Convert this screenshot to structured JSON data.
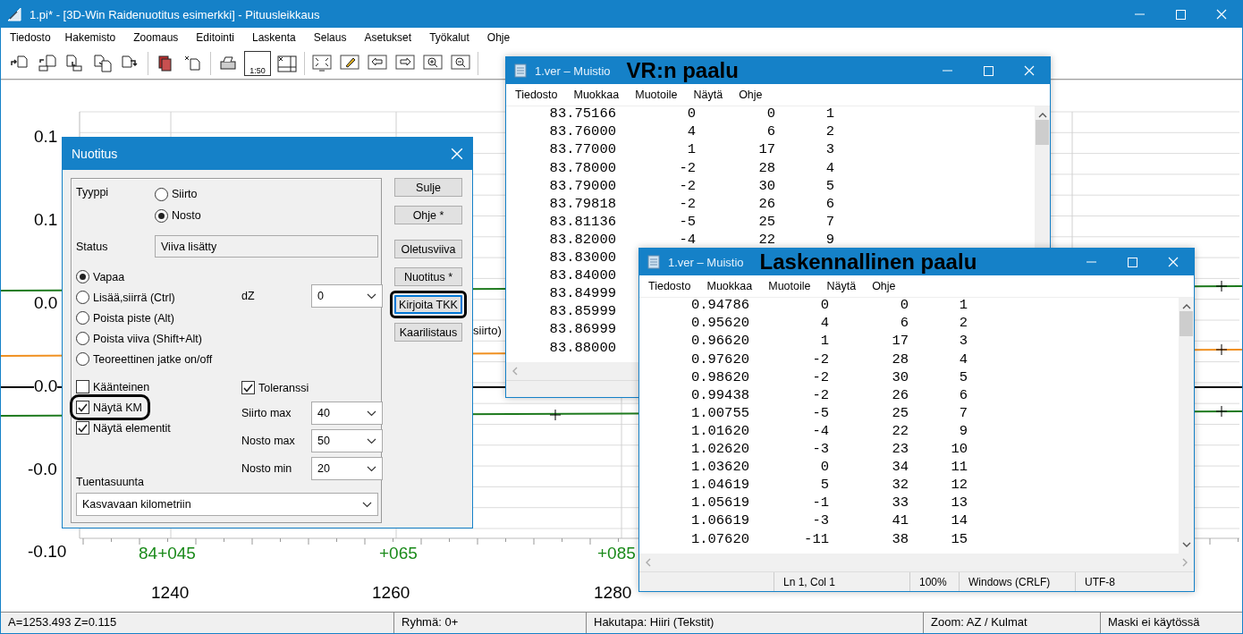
{
  "window": {
    "title": "1.pi* - [3D-Win Raidenuotitus esimerkki] - Pituusleikkaus"
  },
  "menu": [
    "Tiedosto",
    "Hakemisto",
    "Zoomaus",
    "Editointi",
    "Laskenta",
    "Selaus",
    "Asetukset",
    "Työkalut",
    "Ohje"
  ],
  "toolbar": {
    "scale_label": "1:50"
  },
  "chart": {
    "y_labels": [
      "0.1",
      "0.1",
      "0.0",
      "0.0",
      "-0.0",
      "-0.10"
    ],
    "x_labels": [
      "1240",
      "1260",
      "1280"
    ],
    "station_labels": [
      "84+045",
      "+065",
      "+085"
    ],
    "note": "siirto)"
  },
  "status_bar": [
    "A=1253.493  Z=0.115",
    "Ryhmä: 0+",
    "Hakutapa: Hiiri (Tekstit)",
    "Zoom: AZ  /  Kulmat",
    "Maski ei käytössä"
  ],
  "dialog": {
    "title": "Nuotitus",
    "type_label": "Tyyppi",
    "type_options": [
      {
        "label": "Siirto",
        "selected": false
      },
      {
        "label": "Nosto",
        "selected": true
      }
    ],
    "status_label": "Status",
    "status_value": "Viiva lisätty",
    "modes": [
      {
        "label": "Vapaa",
        "selected": true
      },
      {
        "label": "Lisää,siirrä  (Ctrl)",
        "selected": false
      },
      {
        "label": "Poista piste  (Alt)",
        "selected": false
      },
      {
        "label": "Poista viiva  (Shift+Alt)",
        "selected": false
      },
      {
        "label": "Teoreettinen jatke on/off",
        "selected": false
      }
    ],
    "checkboxes": [
      {
        "label": "Käänteinen",
        "checked": false,
        "highlighted": false
      },
      {
        "label": "Näytä KM",
        "checked": true,
        "highlighted": true
      },
      {
        "label": "Näytä elementit",
        "checked": true,
        "highlighted": false
      }
    ],
    "dz": {
      "label": "dZ",
      "value": "0"
    },
    "tolerance": {
      "label": "Toleranssi",
      "checked": true
    },
    "limits": [
      {
        "label": "Siirto max",
        "value": "40"
      },
      {
        "label": "Nosto max",
        "value": "50"
      },
      {
        "label": "Nosto min",
        "value": "20"
      }
    ],
    "direction": {
      "label": "Tuentasuunta",
      "value": "Kasvavaan kilometriin"
    },
    "buttons": [
      {
        "label": "Sulje",
        "highlighted": false
      },
      {
        "label": "Ohje *",
        "highlighted": false
      },
      {
        "label": "Oletusviiva",
        "highlighted": false
      },
      {
        "label": "Nuotitus *",
        "highlighted": false
      },
      {
        "label": "Kirjoita TKK",
        "highlighted": true
      },
      {
        "label": "Kaarilistaus",
        "highlighted": false
      }
    ]
  },
  "notepads": [
    {
      "title": "1.ver – Muistio",
      "annotation": "VR:n paalu",
      "menu": [
        "Tiedosto",
        "Muokkaa",
        "Muotoile",
        "Näytä",
        "Ohje"
      ],
      "rows": [
        [
          "83.75166",
          "0",
          "0",
          "1"
        ],
        [
          "83.76000",
          "4",
          "6",
          "2"
        ],
        [
          "83.77000",
          "1",
          "17",
          "3"
        ],
        [
          "83.78000",
          "-2",
          "28",
          "4"
        ],
        [
          "83.79000",
          "-2",
          "30",
          "5"
        ],
        [
          "83.79818",
          "-2",
          "26",
          "6"
        ],
        [
          "83.81136",
          "-5",
          "25",
          "7"
        ],
        [
          "83.82000",
          "-4",
          "22",
          "9"
        ],
        [
          "83.83000"
        ],
        [
          "83.84000"
        ],
        [
          "83.84999"
        ],
        [
          "83.85999"
        ],
        [
          "83.86999"
        ],
        [
          "83.88000"
        ]
      ]
    },
    {
      "title": "1.ver – Muistio",
      "annotation": "Laskennallinen paalu",
      "menu": [
        "Tiedosto",
        "Muokkaa",
        "Muotoile",
        "Näytä",
        "Ohje"
      ],
      "rows": [
        [
          "0.94786",
          "0",
          "0",
          "1"
        ],
        [
          "0.95620",
          "4",
          "6",
          "2"
        ],
        [
          "0.96620",
          "1",
          "17",
          "3"
        ],
        [
          "0.97620",
          "-2",
          "28",
          "4"
        ],
        [
          "0.98620",
          "-2",
          "30",
          "5"
        ],
        [
          "0.99438",
          "-2",
          "26",
          "6"
        ],
        [
          "1.00755",
          "-5",
          "25",
          "7"
        ],
        [
          "1.01620",
          "-4",
          "22",
          "9"
        ],
        [
          "1.02620",
          "-3",
          "23",
          "10"
        ],
        [
          "1.03620",
          "0",
          "34",
          "11"
        ],
        [
          "1.04619",
          "5",
          "32",
          "12"
        ],
        [
          "1.05619",
          "-1",
          "33",
          "13"
        ],
        [
          "1.06619",
          "-3",
          "41",
          "14"
        ],
        [
          "1.07620",
          "-11",
          "38",
          "15"
        ]
      ],
      "status": [
        "Ln 1, Col 1",
        "100%",
        "Windows (CRLF)",
        "UTF-8"
      ]
    }
  ]
}
